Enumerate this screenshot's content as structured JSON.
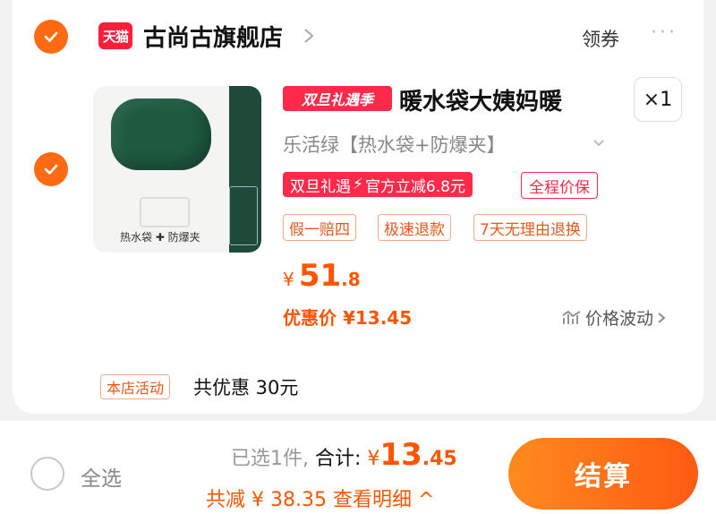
{
  "store": {
    "platform_logo": "天猫",
    "name": "古尚古旗舰店",
    "coupon_label": "领券",
    "more_label": "···"
  },
  "item": {
    "promo_tag": "双旦礼遇季",
    "title": "暖水袋大姨妈暖",
    "quantity": "×1",
    "variant": "乐活绿【热水袋+防爆夹】",
    "thumb_caption": "热水袋 ✚ 防爆夹",
    "discount_tag_left": "双旦礼遇",
    "discount_tag_right": "官方立减6.8元",
    "price_protect": "全程价保",
    "services": [
      "假一赔四",
      "极速退款",
      "7天无理由退换"
    ],
    "price_currency": "¥",
    "price_int": "51",
    "price_dec": ".8",
    "deal_price": "优惠价 ¥13.45",
    "price_trend": "价格波动"
  },
  "activity": {
    "tag": "本店活动",
    "text": "共优惠 30元"
  },
  "footer": {
    "select_all": "全选",
    "selected": "已选1件,",
    "total_label": " 合计:",
    "total_currency": "¥",
    "total_int": "13",
    "total_dec": ".45",
    "saving": "共减 ¥ 38.35  查看明细 ^",
    "checkout": "结算"
  },
  "colors": {
    "accent": "#ff5500",
    "checkbox": "#ff6a12",
    "tmall_red": "#ff1e3a"
  }
}
